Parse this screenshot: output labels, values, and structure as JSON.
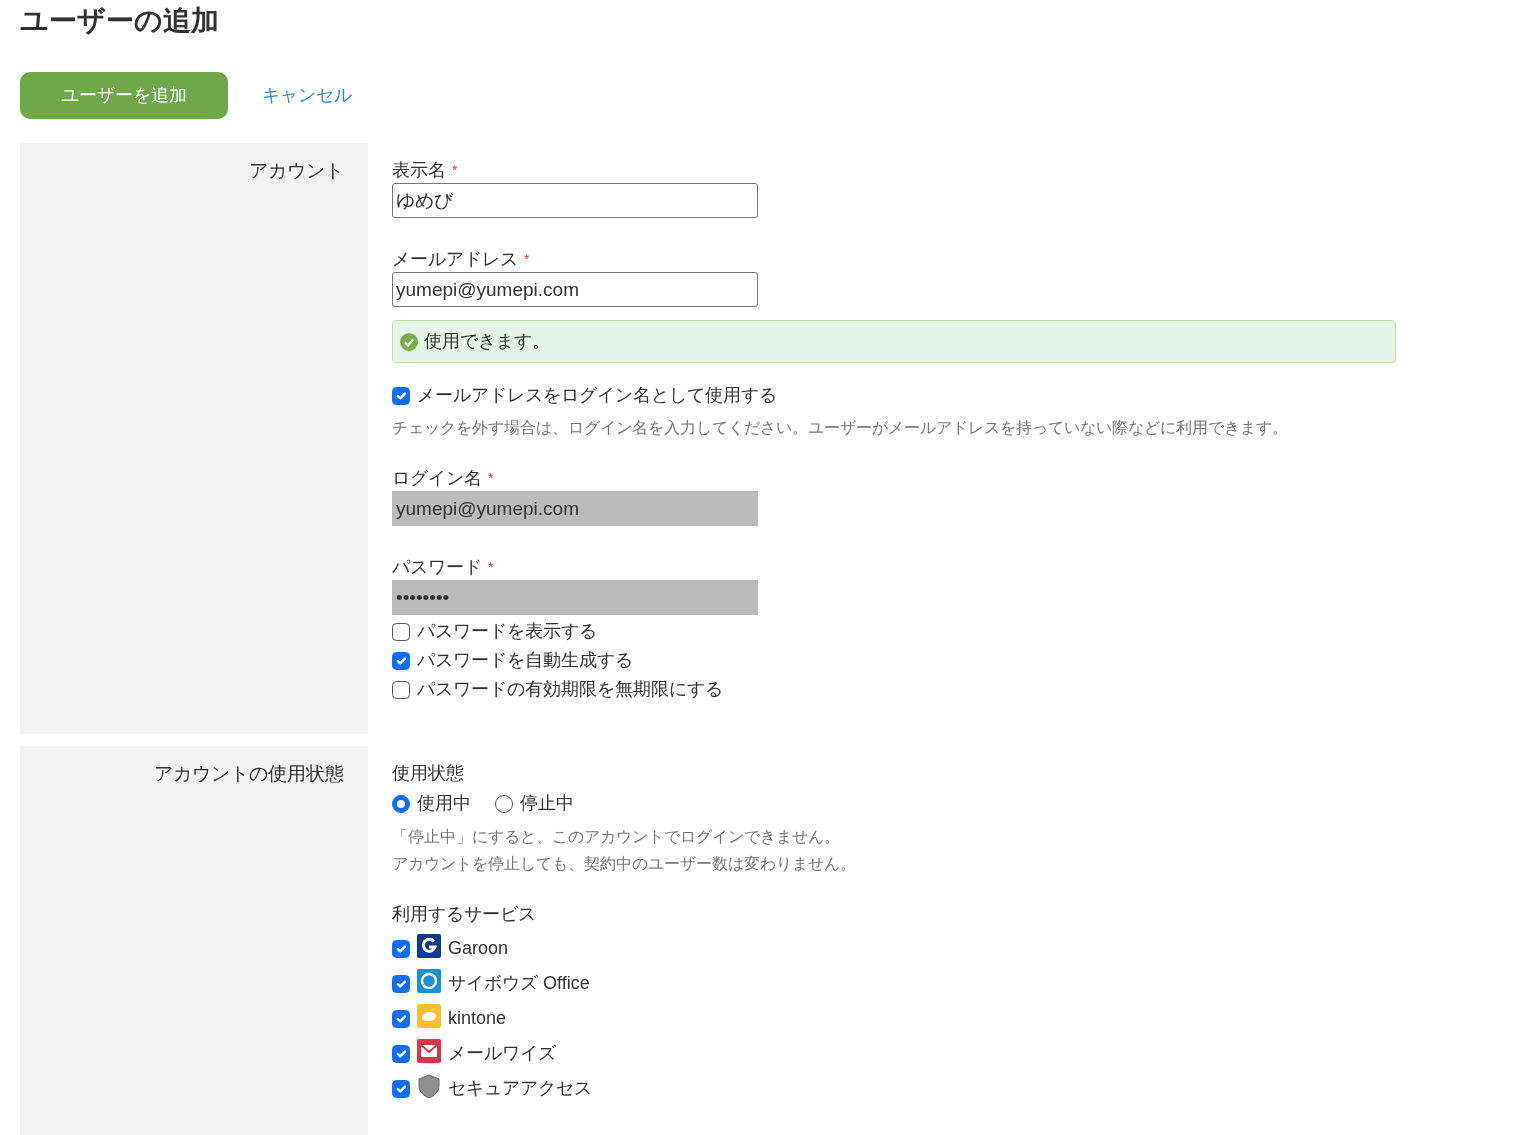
{
  "page": {
    "title": "ユーザーの追加"
  },
  "actions": [
    {
      "kind": "primary",
      "label": "ユーザーを追加"
    },
    {
      "kind": "link",
      "label": "キャンセル"
    }
  ],
  "sections": [
    {
      "heading": "アカウント",
      "items": [
        {
          "kind": "input",
          "label": "表示名",
          "required_mark": "*",
          "value": "ゆめび",
          "disabled": false
        },
        {
          "kind": "input",
          "label": "メールアドレス",
          "required_mark": "*",
          "value": "yumepi@yumepi.com",
          "disabled": false
        },
        {
          "kind": "notice",
          "text": "使用できます。"
        },
        {
          "kind": "checkbox",
          "label": "メールアドレスをログイン名として使用する",
          "checked": true
        },
        {
          "kind": "hint",
          "text": "チェックを外す場合は、ログイン名を入力してください。ユーザーがメールアドレスを持っていない際などに利用できます。"
        },
        {
          "kind": "input",
          "label": "ログイン名",
          "required_mark": "*",
          "value": "yumepi@yumepi.com",
          "disabled": true
        },
        {
          "kind": "input",
          "label": "パスワード",
          "required_mark": "*",
          "value": "••••••••",
          "disabled": true
        },
        {
          "kind": "checkbox",
          "label": "パスワードを表示する",
          "checked": false
        },
        {
          "kind": "checkbox",
          "label": "パスワードを自動生成する",
          "checked": true
        },
        {
          "kind": "checkbox",
          "label": "パスワードの有効期限を無期限にする",
          "checked": false
        }
      ]
    },
    {
      "heading": "アカウントの使用状態",
      "items": [
        {
          "kind": "label",
          "text": "使用状態"
        },
        {
          "kind": "radios",
          "options": [
            {
              "label": "使用中",
              "selected": true
            },
            {
              "label": "停止中",
              "selected": false
            }
          ]
        },
        {
          "kind": "hint",
          "text": "「停止中」にすると、このアカウントでログインできません。"
        },
        {
          "kind": "hint",
          "text": "アカウントを停止しても、契約中のユーザー数は変わりません。"
        },
        {
          "kind": "label",
          "text": "利用するサービス"
        },
        {
          "kind": "services",
          "items": [
            {
              "kind": "garoon",
              "label": "Garoon",
              "checked": true
            },
            {
              "kind": "office",
              "label": "サイボウズ Office",
              "checked": true
            },
            {
              "kind": "kintone",
              "label": "kintone",
              "checked": true
            },
            {
              "kind": "mailwise",
              "label": "メールワイズ",
              "checked": true
            },
            {
              "kind": "secure",
              "label": "セキュアアクセス",
              "checked": true
            }
          ]
        }
      ]
    }
  ]
}
